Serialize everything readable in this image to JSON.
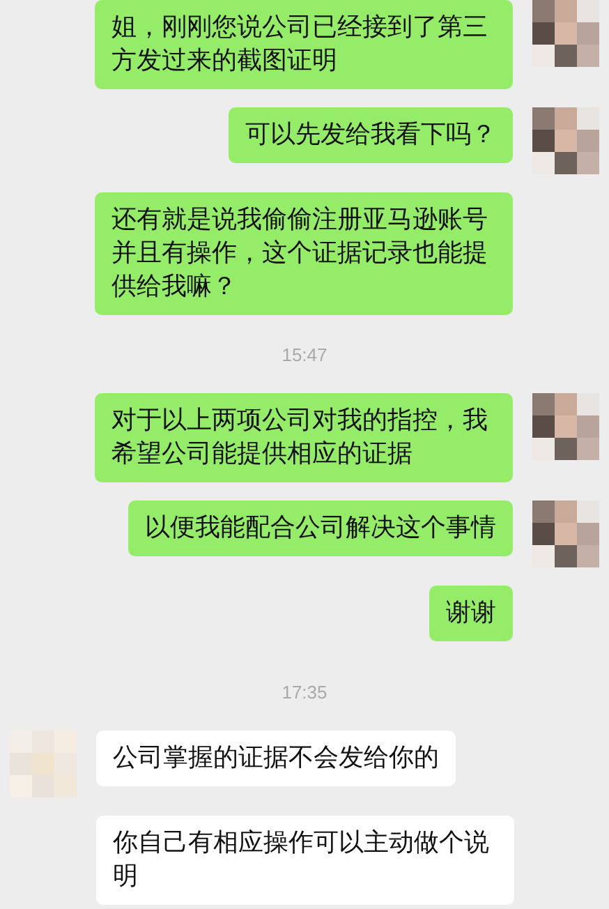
{
  "messages": [
    {
      "kind": "message",
      "outgoing": true,
      "avatar": true,
      "text": "姐，刚刚您说公司已经接到了第三方发过来的截图证明"
    },
    {
      "kind": "message",
      "outgoing": true,
      "avatar": true,
      "text": "可以先发给我看下吗？"
    },
    {
      "kind": "message",
      "outgoing": true,
      "avatar": false,
      "text": "还有就是说我偷偷注册亚马逊账号并且有操作，这个证据记录也能提供给我嘛？"
    },
    {
      "kind": "time",
      "text": "15:47"
    },
    {
      "kind": "message",
      "outgoing": true,
      "avatar": true,
      "text": "对于以上两项公司对我的指控，我希望公司能提供相应的证据"
    },
    {
      "kind": "message",
      "outgoing": true,
      "avatar": true,
      "text": "以便我能配合公司解决这个事情"
    },
    {
      "kind": "message",
      "outgoing": true,
      "avatar": false,
      "text": "谢谢"
    },
    {
      "kind": "time",
      "text": "17:35"
    },
    {
      "kind": "message",
      "outgoing": false,
      "avatar": true,
      "text": "公司掌握的证据不会发给你的"
    },
    {
      "kind": "message",
      "outgoing": false,
      "avatar": false,
      "text": "你自己有相应操作可以主动做个说明"
    }
  ]
}
